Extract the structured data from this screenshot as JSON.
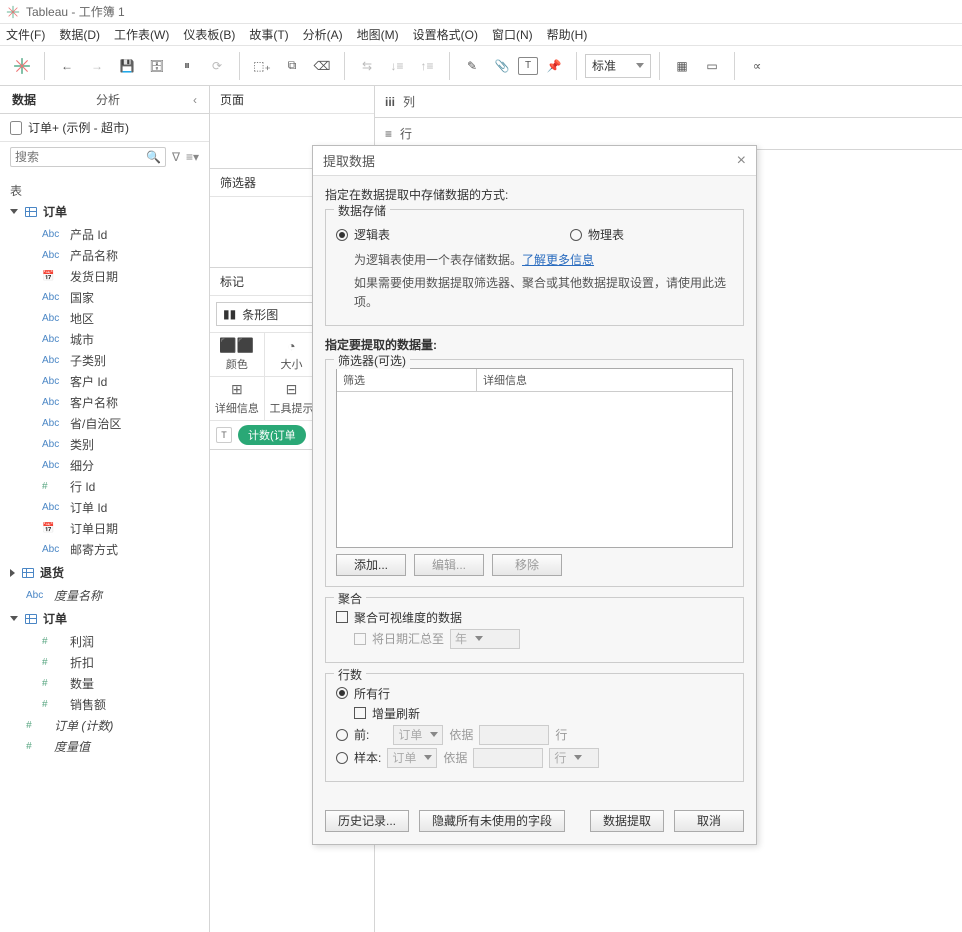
{
  "title": "Tableau - 工作簿 1",
  "menu": [
    "文件(F)",
    "数据(D)",
    "工作表(W)",
    "仪表板(B)",
    "故事(T)",
    "分析(A)",
    "地图(M)",
    "设置格式(O)",
    "窗口(N)",
    "帮助(H)"
  ],
  "toolbar": {
    "view_mode": "标准"
  },
  "side": {
    "tab_data": "数据",
    "tab_analysis": "分析",
    "datasource": "订单+ (示例 - 超市)",
    "search_ph": "搜索",
    "tables_label": "表",
    "group_orders": "订单",
    "orders_fields": [
      {
        "icon": "Abc",
        "label": "产品 Id"
      },
      {
        "icon": "Abc",
        "label": "产品名称"
      },
      {
        "icon": "📅",
        "label": "发货日期"
      },
      {
        "icon": "Abc",
        "label": "国家"
      },
      {
        "icon": "Abc",
        "label": "地区"
      },
      {
        "icon": "Abc",
        "label": "城市"
      },
      {
        "icon": "Abc",
        "label": "子类别"
      },
      {
        "icon": "Abc",
        "label": "客户 Id"
      },
      {
        "icon": "Abc",
        "label": "客户名称"
      },
      {
        "icon": "Abc",
        "label": "省/自治区"
      },
      {
        "icon": "Abc",
        "label": "类别"
      },
      {
        "icon": "Abc",
        "label": "细分"
      },
      {
        "icon": "#",
        "label": "行 Id",
        "num": true
      },
      {
        "icon": "Abc",
        "label": "订单 Id"
      },
      {
        "icon": "📅",
        "label": "订单日期"
      },
      {
        "icon": "Abc",
        "label": "邮寄方式"
      }
    ],
    "group_returns": "退货",
    "measure_names": "度量名称",
    "group_orders2": "订单",
    "measures": [
      {
        "icon": "#",
        "label": "利润"
      },
      {
        "icon": "#",
        "label": "折扣"
      },
      {
        "icon": "#",
        "label": "数量"
      },
      {
        "icon": "#",
        "label": "销售额"
      }
    ],
    "ital1": "订单 (计数)",
    "ital2": "度量值"
  },
  "mid": {
    "pages": "页面",
    "filters": "筛选器",
    "marks": "标记",
    "mark_type": "条形图",
    "cells": [
      "颜色",
      "大小",
      "",
      "详细信息",
      "工具提示",
      ""
    ],
    "pill_pre": "T",
    "pill": "计数(订单"
  },
  "shelves": {
    "cols": "列",
    "rows": "行"
  },
  "dlg": {
    "title": "提取数据",
    "intro": "指定在数据提取中存储数据的方式:",
    "storage_legend": "数据存储",
    "radio_logic": "逻辑表",
    "radio_phys": "物理表",
    "desc1_a": "为逻辑表使用一个表存储数据。",
    "desc1_link": "了解更多信息",
    "desc2": "如果需要使用数据提取筛选器、聚合或其他数据提取设置，请使用此选项。",
    "amount": "指定要提取的数据量:",
    "filters_legend": "筛选器(可选)",
    "filters_h1": "筛选",
    "filters_h2": "详细信息",
    "btn_add": "添加...",
    "btn_edit": "编辑...",
    "btn_remove": "移除",
    "agg_legend": "聚合",
    "agg_chk": "聚合可视维度的数据",
    "agg_date": "将日期汇总至",
    "agg_date_val": "年",
    "rows_legend": "行数",
    "rows_all": "所有行",
    "rows_inc": "增量刷新",
    "rows_top": "前:",
    "rows_sample": "样本:",
    "sel_order": "订单",
    "lbl_by": "依据",
    "lbl_rows": "行",
    "foot_history": "历史记录...",
    "foot_hide": "隐藏所有未使用的字段",
    "foot_extract": "数据提取",
    "foot_cancel": "取消"
  }
}
